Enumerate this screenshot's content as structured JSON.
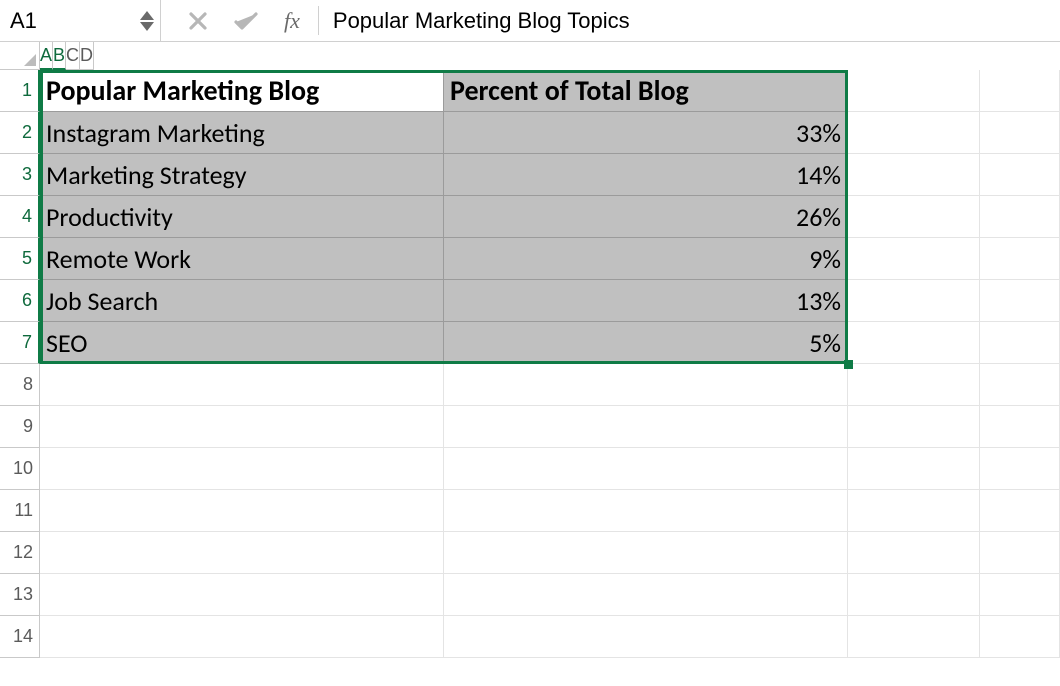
{
  "name_box": {
    "value": "A1"
  },
  "formula_bar": {
    "cancel_label": "Cancel",
    "confirm_label": "Enter",
    "fx_label": "fx",
    "value": "Popular Marketing Blog Topics"
  },
  "columns": [
    {
      "label": "A",
      "class": "wA",
      "active": true
    },
    {
      "label": "B",
      "class": "wB",
      "active": true
    },
    {
      "label": "C",
      "class": "wC",
      "active": false
    },
    {
      "label": "D",
      "class": "wD",
      "active": false
    }
  ],
  "active_cell": "A1",
  "selection_range": "A1:B7",
  "headers": [
    "Popular Marketing Blog",
    "Percent of Total Blog"
  ],
  "data_rows": [
    {
      "topic": "Instagram Marketing",
      "percent": "33%"
    },
    {
      "topic": "Marketing Strategy",
      "percent": "14%"
    },
    {
      "topic": "Productivity",
      "percent": "26%"
    },
    {
      "topic": "Remote Work",
      "percent": "9%"
    },
    {
      "topic": "Job Search",
      "percent": "13%"
    },
    {
      "topic": "SEO",
      "percent": "5%"
    }
  ],
  "empty_rows_after": 7,
  "chart_data": {
    "type": "table",
    "columns": [
      "Popular Marketing Blog",
      "Percent of Total Blog"
    ],
    "rows": [
      [
        "Instagram Marketing",
        0.33
      ],
      [
        "Marketing Strategy",
        0.14
      ],
      [
        "Productivity",
        0.26
      ],
      [
        "Remote Work",
        0.09
      ],
      [
        "Job Search",
        0.13
      ],
      [
        "SEO",
        0.05
      ]
    ]
  }
}
